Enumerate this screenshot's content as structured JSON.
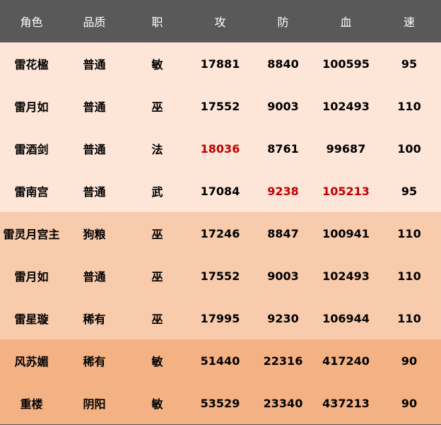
{
  "headers": [
    "角色",
    "品质",
    "职",
    "攻",
    "防",
    "血",
    "速"
  ],
  "rows": [
    {
      "group": 1,
      "cells": [
        "雷花楹",
        "普通",
        "敏",
        "17881",
        "8840",
        "100595",
        "95"
      ],
      "highlight": []
    },
    {
      "group": 1,
      "cells": [
        "雷月如",
        "普通",
        "巫",
        "17552",
        "9003",
        "102493",
        "110"
      ],
      "highlight": []
    },
    {
      "group": 1,
      "cells": [
        "雷酒剑",
        "普通",
        "法",
        "18036",
        "8761",
        "99687",
        "100"
      ],
      "highlight": [
        3
      ]
    },
    {
      "group": 1,
      "cells": [
        "雷南宫",
        "普通",
        "武",
        "17084",
        "9238",
        "105213",
        "95"
      ],
      "highlight": [
        4,
        5
      ]
    },
    {
      "group": 2,
      "cells": [
        "雷灵月宫主",
        "狗粮",
        "巫",
        "17246",
        "8847",
        "100941",
        "110"
      ],
      "highlight": []
    },
    {
      "group": 2,
      "cells": [
        "雷月如",
        "普通",
        "巫",
        "17552",
        "9003",
        "102493",
        "110"
      ],
      "highlight": []
    },
    {
      "group": 2,
      "cells": [
        "雷星璇",
        "稀有",
        "巫",
        "17995",
        "9230",
        "106944",
        "110"
      ],
      "highlight": []
    },
    {
      "group": 3,
      "cells": [
        "风苏媚",
        "稀有",
        "敏",
        "51440",
        "22316",
        "417240",
        "90"
      ],
      "highlight": []
    },
    {
      "group": 3,
      "cells": [
        "重楼",
        "阴阳",
        "敏",
        "53529",
        "23340",
        "437213",
        "90"
      ],
      "highlight": []
    }
  ],
  "colors": {
    "header_bg": "#595959",
    "group1_bg": "#fde5d8",
    "group2_bg": "#f8cbad",
    "group3_bg": "#f4b183",
    "highlight_text": "#c00000"
  }
}
